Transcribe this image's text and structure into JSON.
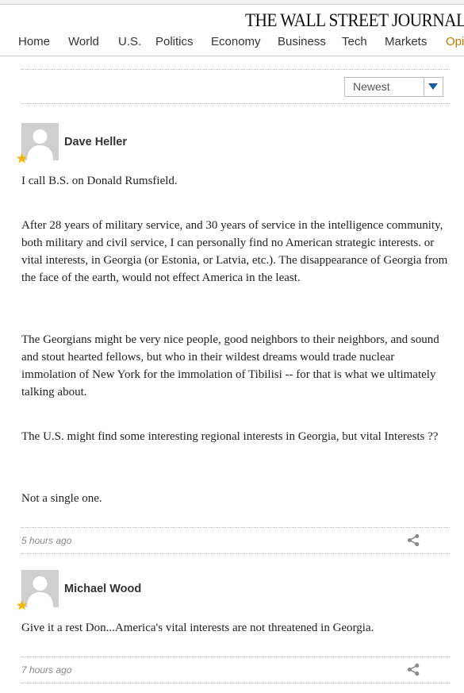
{
  "header": {
    "logo": "THE WALL STREET JOURNAL.",
    "nav": [
      "Home",
      "World",
      "U.S.",
      "Politics",
      "Economy",
      "Business",
      "Tech",
      "Markets",
      "Opinion"
    ]
  },
  "sort": {
    "selected": "Newest"
  },
  "comments": [
    {
      "author": "Dave Heller",
      "paragraphs": [
        "I call B.S. on Donald Rumsfield.",
        "After 28 years of military service, and 30 years of service in the intelligence community, both military and civil service, I can personally find no American strategic interests. or vital interests, in Georgia (or Estonia, or Latvia, etc.).  The disappearance of Georgia from the face of the earth, would not effect America in the least.",
        "The Georgians might be very nice people, good neighbors to their neighbors, and sound and stout hearted fellows, but who in their wildest dreams would trade nuclear immolation of New York for the immolation of Tibilisi -- for that is what we ultimately talking about.",
        "The U.S. might find some interesting regional interests in Georgia, but vital Interests ??",
        "Not a single one."
      ],
      "time": "5 hours ago"
    },
    {
      "author": "Michael Wood",
      "paragraphs": [
        "Give it a rest Don...America's vital interests are not threatened in Georgia."
      ],
      "time": "7 hours ago"
    }
  ],
  "colors": {
    "star": "#f2b705",
    "accent_nav": "#c07a00",
    "sort_arrow": "#1a5a9a"
  },
  "icons": {
    "share": "share-icon",
    "star": "star-icon",
    "dropdown": "chevron-down-icon"
  }
}
